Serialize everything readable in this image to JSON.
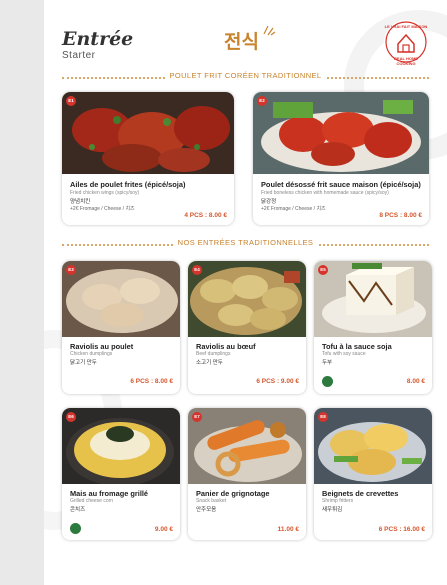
{
  "header": {
    "title": "Entrée",
    "subtitle": "Starter",
    "korean_title": "전식",
    "logo_text_top": "LE VRAI FAIT MAISON",
    "logo_text_bottom": "REAL HOME COOKING"
  },
  "sections": [
    {
      "label": "POULET FRIT CORÉEN TRADITIONNEL",
      "items": [
        {
          "code": "E1",
          "name": "Ailes de poulet frites (épicé/soja)",
          "en": "Fried chicken wings (spicy/soy)",
          "ko": "양념치킨",
          "extra": "+2€ Fromage / Cheese / 치즈",
          "price": "4 PCS : 8.00 €",
          "veg": false,
          "photo": "fried-chicken-wings"
        },
        {
          "code": "E2",
          "name": "Poulet désossé frit sauce maison (épicé/soja)",
          "en": "Fried boneless chicken with homemade sauce (spicy/soy)",
          "ko": "닭강정",
          "extra": "+2€ Fromage / Cheese / 치즈",
          "price": "8 PCS : 8.00 €",
          "veg": false,
          "photo": "boneless-chicken"
        }
      ]
    },
    {
      "label": "NOS ENTRÉES TRADITIONNELLES",
      "items": [
        {
          "code": "E3",
          "name": "Raviolis au poulet",
          "en": "Chicken dumplings",
          "ko": "닭고기 만두",
          "price": "6 PCS : 8.00 €",
          "veg": false,
          "photo": "chicken-dumplings"
        },
        {
          "code": "E4",
          "name": "Raviolis au bœuf",
          "en": "Beef dumplings",
          "ko": "소고기 만두",
          "price": "6 PCS : 9.00 €",
          "veg": false,
          "photo": "beef-dumplings"
        },
        {
          "code": "E5",
          "name": "Tofu à la sauce soja",
          "en": "Tofu with soy sauce",
          "ko": "두부",
          "price": "8.00 €",
          "veg": true,
          "photo": "tofu"
        },
        {
          "code": "E6",
          "name": "Mais au fromage grillé",
          "en": "Grilled cheese corn",
          "ko": "콘치즈",
          "price": "9.00 €",
          "veg": true,
          "photo": "cheese-corn"
        },
        {
          "code": "E7",
          "name": "Panier de grignotage",
          "en": "Snack basket",
          "ko": "안주모음",
          "price": "11.00 €",
          "veg": false,
          "photo": "snack-basket"
        },
        {
          "code": "E8",
          "name": "Beignets de crevettes",
          "en": "Shrimp fritters",
          "ko": "새우튀김",
          "price": "6 PCS : 16.00 €",
          "veg": false,
          "photo": "shrimp-fritters"
        }
      ]
    }
  ],
  "colors": {
    "accent": "#c9832d",
    "code_badge": "#d5342c",
    "price": "#d5562c",
    "veg_badge": "#2c7a3d"
  },
  "icons": {
    "veg": "leaf-icon",
    "logo": "house-logo-icon"
  }
}
